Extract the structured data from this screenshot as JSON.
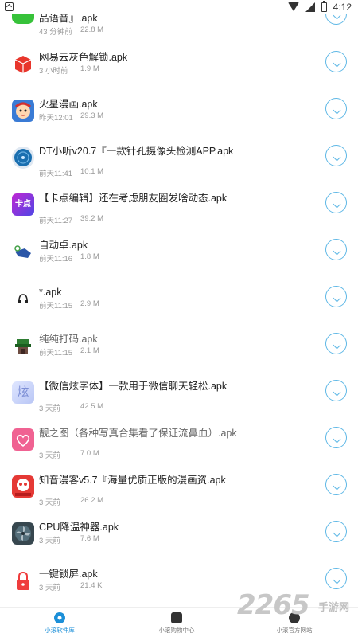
{
  "status_bar": {
    "time": "4:12"
  },
  "files": [
    {
      "title": "品语音』.apk",
      "time": "43 分钟前",
      "size": "22.8 M",
      "icon": "green-app-icon",
      "color": "#37c23a"
    },
    {
      "title": "网易云灰色解锁.apk",
      "time": "3 小时前",
      "size": "1.9 M",
      "icon": "red-box-icon",
      "color": "#e8362c"
    },
    {
      "title": "火星漫画.apk",
      "time": "昨天12:01",
      "size": "29.3 M",
      "icon": "cartoon-face-icon",
      "color": "#3a7bd5"
    },
    {
      "title": "DT小听v20.7『一款针孔摄像头检测APP.apk",
      "time": "前天11:41",
      "size": "10.1 M",
      "icon": "radar-icon",
      "color": "#1a6fb0"
    },
    {
      "title": "【卡点编辑】还在考虑朋友圈发啥动态.apk",
      "time": "前天11:27",
      "size": "39.2 M",
      "icon": "kadian-icon",
      "color": "#8b34e0",
      "icon_text": "卡点"
    },
    {
      "title": "自动卓.apk",
      "time": "前天11:16",
      "size": "1.8 M",
      "icon": "hand-tap-icon",
      "color": "#2b56a8"
    },
    {
      "title": "*.apk",
      "time": "前天11:15",
      "size": "2.9 M",
      "icon": "headphones-icon",
      "color": "#222222"
    },
    {
      "title": "纯纯打码.apk",
      "time": "前天11:15",
      "size": "2.1 M",
      "icon": "pixel-house-icon",
      "color": "#2e7d32",
      "muted": true
    },
    {
      "title": "【微信炫字体】一款用于微信聊天轻松.apk",
      "time": "3 天前",
      "size": "42.5 M",
      "icon": "font-icon",
      "color": "#b9c6f5",
      "icon_text": "炫"
    },
    {
      "title": "靓之图（各种写真合集看了保证流鼻血）.apk",
      "time": "3 天前",
      "size": "7.0 M",
      "icon": "heart-icon",
      "color": "#f06292",
      "muted": true
    },
    {
      "title": "知音漫客v5.7『海量优质正版的漫画资.apk",
      "time": "3 天前",
      "size": "26.2 M",
      "icon": "zhiyin-icon",
      "color": "#e53935"
    },
    {
      "title": "CPU降温神器.apk",
      "time": "3 天前",
      "size": "7.6 M",
      "icon": "fan-icon",
      "color": "#37474f"
    },
    {
      "title": "一键锁屏.apk",
      "time": "3 天前",
      "size": "21.4 K",
      "icon": "lock-icon",
      "color": "#ef3d3d"
    }
  ],
  "nav": [
    {
      "label": "小滚软件库",
      "icon": "gear-icon",
      "color": "#1b8fd8",
      "active": true
    },
    {
      "label": "小滚购物中心",
      "icon": "shop-icon",
      "color": "#333333",
      "active": false
    },
    {
      "label": "小滚官方网站",
      "icon": "globe-icon",
      "color": "#333333",
      "active": false
    }
  ],
  "watermark": {
    "number": "2265",
    "text": "手游网"
  }
}
